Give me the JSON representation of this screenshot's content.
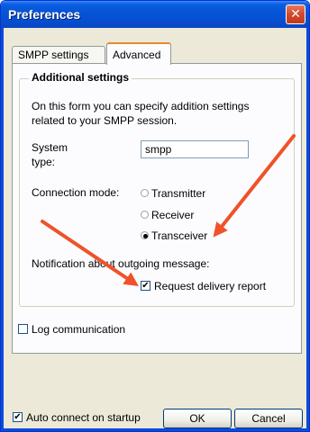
{
  "window": {
    "title": "Preferences",
    "close_glyph": "✕"
  },
  "tabs": [
    {
      "label": "SMPP settings",
      "active": false
    },
    {
      "label": "Advanced",
      "active": true
    }
  ],
  "group": {
    "title": "Additional settings",
    "description_line1": "On this form you can specify addition settings",
    "description_line2": "related to your SMPP session.",
    "system_type": {
      "label_line1": "System",
      "label_line2": "type:",
      "value": "smpp"
    },
    "connection_mode": {
      "label": "Connection mode:",
      "options": [
        "Transmitter",
        "Receiver",
        "Transceiver"
      ],
      "selected": "Transceiver"
    },
    "notification": {
      "label": "Notification about outgoing message:",
      "checkbox_label": "Request delivery report",
      "checked": true
    }
  },
  "log_communication": {
    "label": "Log communication",
    "checked": false
  },
  "auto_connect": {
    "label": "Auto connect on startup",
    "checked": true
  },
  "buttons": {
    "ok": "OK",
    "cancel": "Cancel"
  },
  "colors": {
    "titlebar": "#0654d8",
    "arrow": "#f0522a",
    "dialog_bg": "#ece9d8"
  }
}
